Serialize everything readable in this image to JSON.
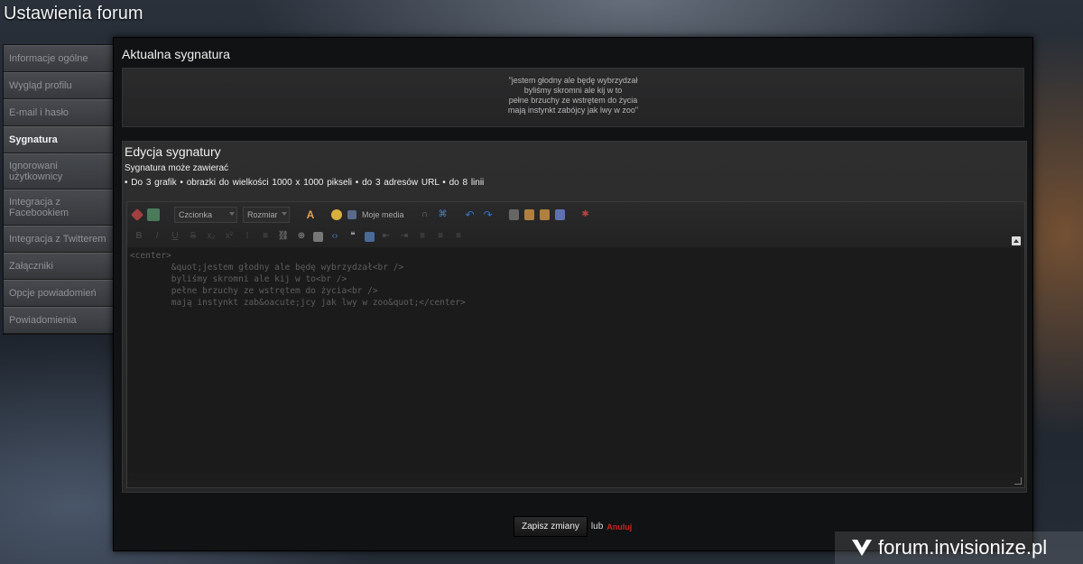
{
  "page": {
    "title": "Ustawienia forum"
  },
  "sidebar": {
    "items": [
      {
        "label": "Informacje ogólne",
        "active": false
      },
      {
        "label": "Wygląd profilu",
        "active": false
      },
      {
        "label": "E-mail i hasło",
        "active": false
      },
      {
        "label": "Sygnatura",
        "active": true
      },
      {
        "label": "Ignorowani użytkownicy",
        "active": false
      },
      {
        "label": "Integracja z Facebookiem",
        "active": false
      },
      {
        "label": "Integracja z Twitterem",
        "active": false
      },
      {
        "label": "Załączniki",
        "active": false
      },
      {
        "label": "Opcje powiadomień",
        "active": false
      },
      {
        "label": "Powiadomienia",
        "active": false
      }
    ]
  },
  "current_signature": {
    "title": "Aktualna sygnatura",
    "lines": [
      "\"jestem głodny ale będę wybrzydzał",
      "byliśmy skromni ale kij w to",
      "pełne brzuchy ze wstrętem do życia",
      "mają instynkt zabójcy jak lwy w zoo\""
    ]
  },
  "edit": {
    "title": "Edycja sygnatury",
    "subtitle": "Sygnatura może zawierać",
    "rules": "• Do 3 grafik   • obrazki do wielkości 1000 x 1000 pikseli   • do 3 adresów URL   • do 8 linii",
    "toolbar": {
      "font_select": "Czcionka",
      "size_select": "Rozmiar",
      "media_label": "Moje media"
    },
    "source": "<center>\n        &quot;jestem głodny ale będę wybrzydzał<br />\n        byliśmy skromni ale kij w to<br />\n        pełne brzuchy ze wstrętem do życia<br />\n        mają instynkt zab&oacute;jcy jak lwy w zoo&quot;</center>"
  },
  "actions": {
    "save_label": "Zapisz zmiany",
    "or_text": "lub",
    "cancel_label": "Anuluj"
  },
  "watermark": {
    "text": "forum.invisionize.pl"
  },
  "colors": {
    "cancel": "#cc2222",
    "panel_bg": "#111213",
    "text": "#f0f0f0"
  }
}
